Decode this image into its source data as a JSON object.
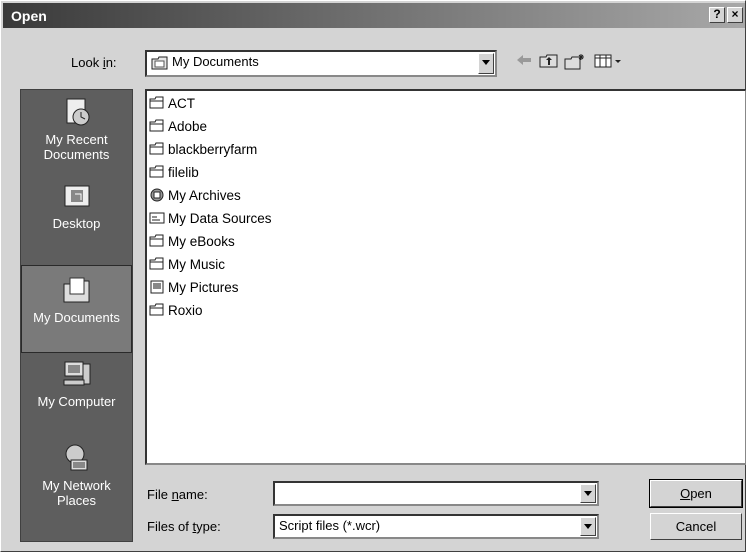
{
  "window": {
    "title": "Open",
    "help_label": "?",
    "close_label": "×"
  },
  "lookin": {
    "label_pre": "Look ",
    "label_u": "i",
    "label_post": "n:",
    "value": "My Documents"
  },
  "toolbar": {
    "back_icon": "back-arrow-icon",
    "up_icon": "up-folder-icon",
    "new_folder_icon": "new-folder-icon",
    "view_icon": "view-menu-icon"
  },
  "places": [
    {
      "label": "My Recent Documents",
      "icon": "recent-documents-icon"
    },
    {
      "label": "Desktop",
      "icon": "desktop-icon"
    },
    {
      "label": "My Documents",
      "icon": "my-documents-icon",
      "selected": true
    },
    {
      "label": "My Computer",
      "icon": "my-computer-icon"
    },
    {
      "label": "My Network Places",
      "icon": "network-places-icon"
    }
  ],
  "files": [
    {
      "name": "ACT",
      "icon": "folder-icon"
    },
    {
      "name": "Adobe",
      "icon": "folder-icon"
    },
    {
      "name": "blackberryfarm",
      "icon": "folder-icon"
    },
    {
      "name": "filelib",
      "icon": "folder-icon"
    },
    {
      "name": "My Archives",
      "icon": "archive-folder-icon"
    },
    {
      "name": "My Data Sources",
      "icon": "data-sources-icon"
    },
    {
      "name": "My eBooks",
      "icon": "folder-icon"
    },
    {
      "name": "My Music",
      "icon": "folder-icon"
    },
    {
      "name": "My Pictures",
      "icon": "pictures-folder-icon"
    },
    {
      "name": "Roxio",
      "icon": "folder-icon"
    }
  ],
  "filename": {
    "label_pre": "File ",
    "label_u": "n",
    "label_post": "ame:",
    "value": ""
  },
  "filetype": {
    "label_pre": "Files of ",
    "label_u": "t",
    "label_post": "ype:",
    "value": "Script files (*.wcr)"
  },
  "buttons": {
    "open_u": "O",
    "open_rest": "pen",
    "cancel": "Cancel"
  }
}
